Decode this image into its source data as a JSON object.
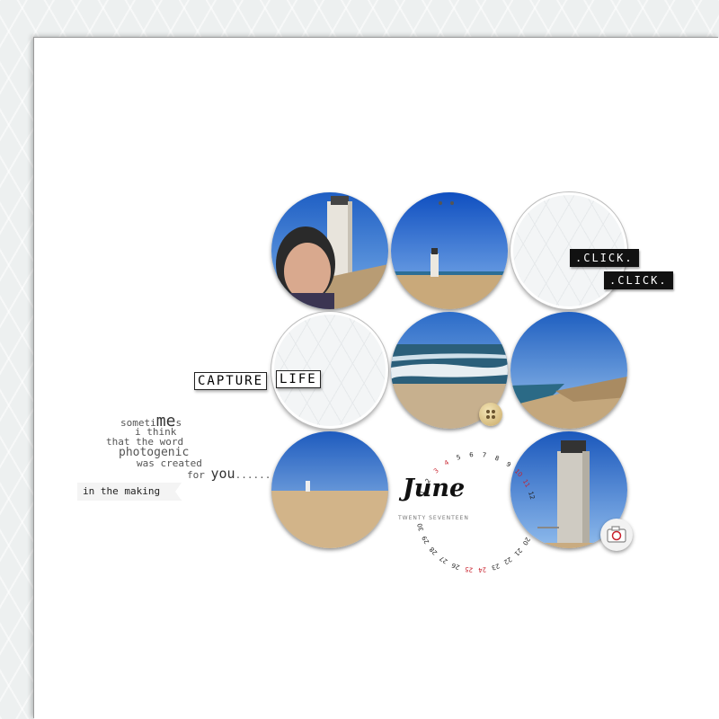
{
  "labels": {
    "click1": ".CLICK.",
    "click2": ".CLICK.",
    "capture": "CAPTURE",
    "life": "LIFE",
    "making": "in the making"
  },
  "poem": {
    "line1a": "someti",
    "line1b": "me",
    "line1c": "s",
    "line2": "i think",
    "line3": "that the word",
    "line4": "photogenic",
    "line5": "was created",
    "line6a": "for ",
    "line6b": "you",
    "line6c": "......"
  },
  "calendar": {
    "month": "June",
    "year": "TWENTY SEVENTEEN",
    "days": [
      "1",
      "2",
      "3",
      "4",
      "5",
      "6",
      "7",
      "8",
      "9",
      "10",
      "11",
      "12",
      "20",
      "21",
      "22",
      "23",
      "24",
      "25",
      "26",
      "27",
      "28",
      "29",
      "30"
    ],
    "highlight_days": [
      "3",
      "4",
      "10",
      "11",
      "24",
      "25"
    ],
    "highlight_color": "#c8202c"
  },
  "photos": [
    {
      "id": "selfie-lighthouse"
    },
    {
      "id": "lighthouse-far"
    },
    {
      "id": "empty"
    },
    {
      "id": "empty"
    },
    {
      "id": "sea-waves"
    },
    {
      "id": "coast-dunes"
    },
    {
      "id": "beach-lighthouse"
    },
    {
      "id": "lighthouse-tower"
    }
  ],
  "colors": {
    "sky": "#2f6fc8",
    "sand": "#c9a97a",
    "sea": "#2b5f7a"
  }
}
